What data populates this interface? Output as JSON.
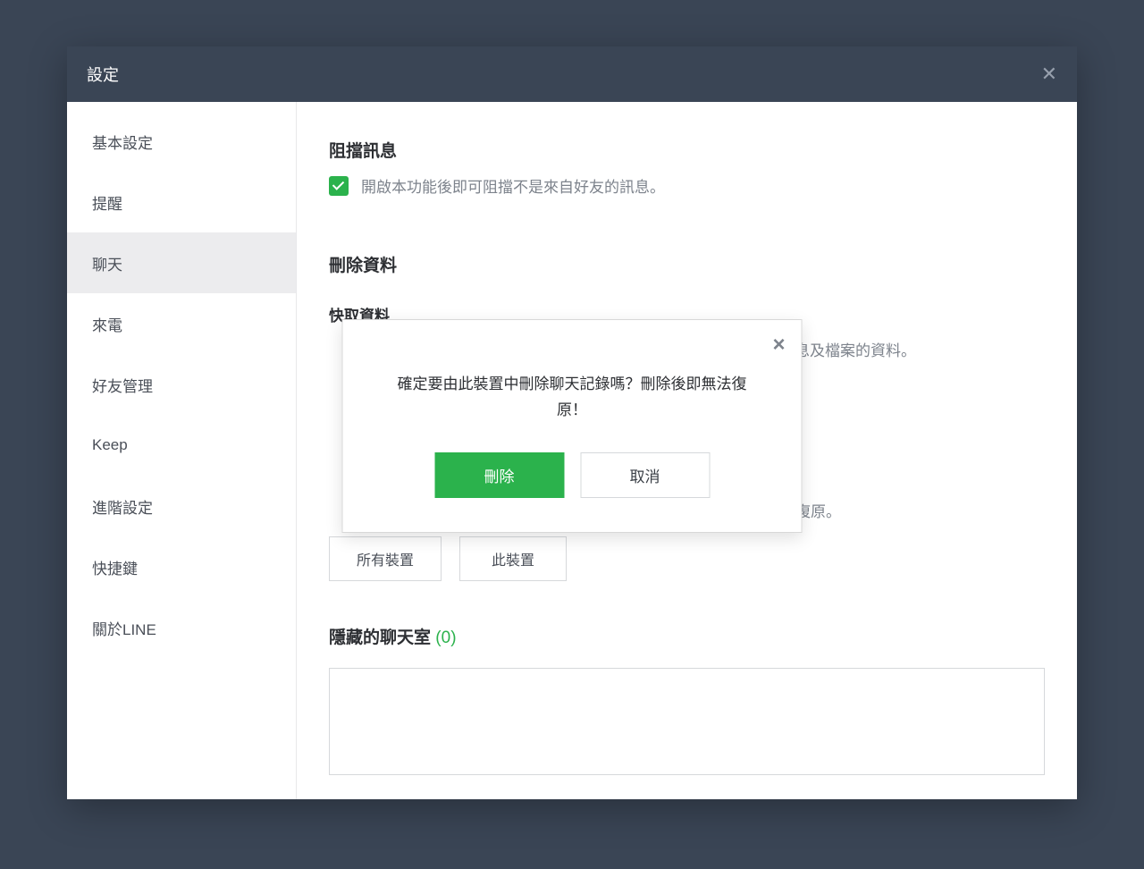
{
  "window": {
    "title": "設定"
  },
  "sidebar": {
    "items": [
      {
        "label": "基本設定",
        "active": false
      },
      {
        "label": "提醒",
        "active": false
      },
      {
        "label": "聊天",
        "active": true
      },
      {
        "label": "來電",
        "active": false
      },
      {
        "label": "好友管理",
        "active": false
      },
      {
        "label": "Keep",
        "active": false
      },
      {
        "label": "進階設定",
        "active": false
      },
      {
        "label": "快捷鍵",
        "active": false
      },
      {
        "label": "關於LINE",
        "active": false
      }
    ]
  },
  "content": {
    "block_msg_title": "阻擋訊息",
    "block_msg_desc": "開啟本功能後即可阻擋不是來自好友的訊息。",
    "delete_data_title": "刪除資料",
    "cache_title": "快取資料",
    "peek_right_1": "息及檔案的資料。",
    "peek_right_2": "復原。",
    "btn_all_devices": "所有裝置",
    "btn_this_device": "此裝置",
    "hidden_title": "隱藏的聊天室",
    "hidden_count": "(0)"
  },
  "modal": {
    "message": "確定要由此裝置中刪除聊天記錄嗎？刪除後即無法復原！",
    "confirm": "刪除",
    "cancel": "取消"
  }
}
